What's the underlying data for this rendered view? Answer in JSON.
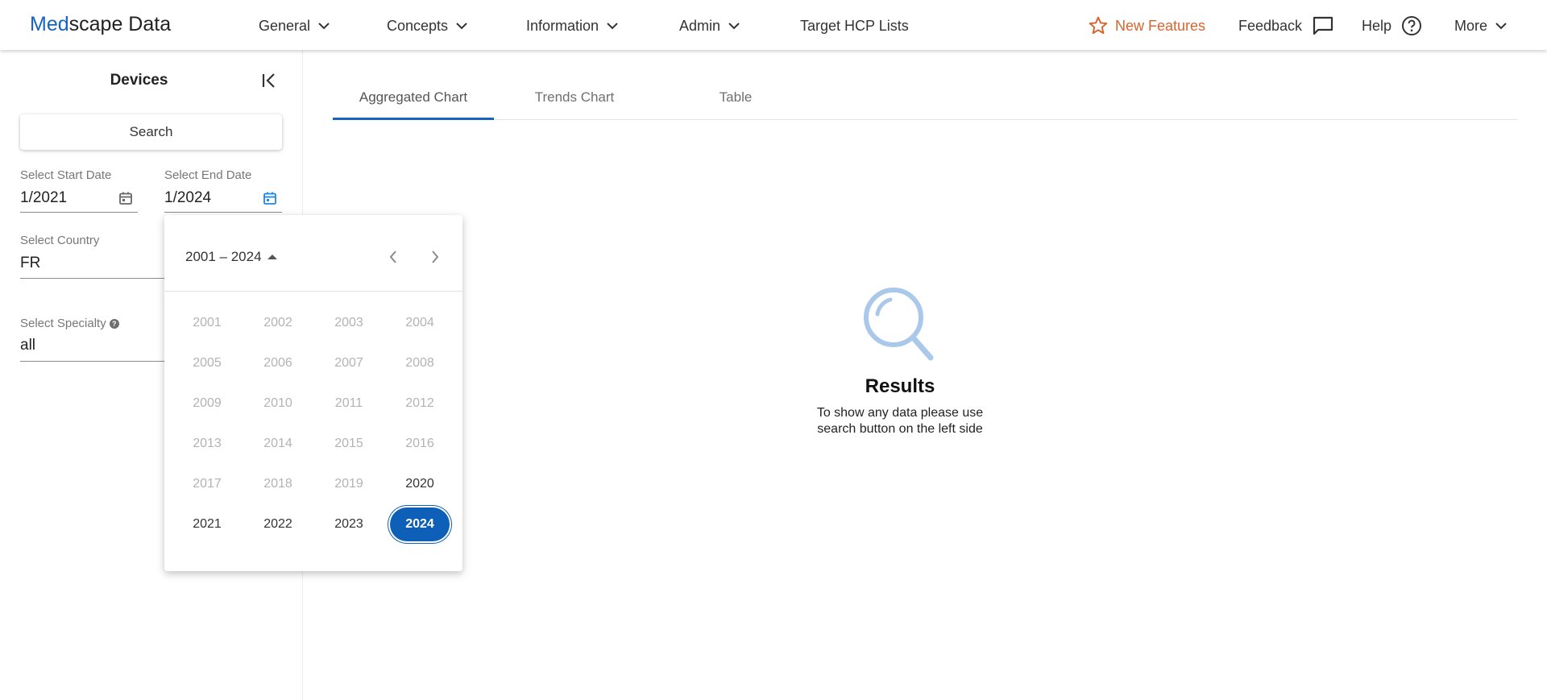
{
  "app": {
    "logo_prefix": "Med",
    "logo_suffix": "scape Data"
  },
  "nav": {
    "general": "General",
    "concepts": "Concepts",
    "information": "Information",
    "admin": "Admin",
    "target_hcp": "Target HCP Lists",
    "new_features": "New Features",
    "feedback": "Feedback",
    "help": "Help",
    "more": "More"
  },
  "sidebar": {
    "title": "Devices",
    "search_label": "Search",
    "start_date": {
      "label": "Select Start Date",
      "value": "1/2021"
    },
    "end_date": {
      "label": "Select End Date",
      "value": "1/2024"
    },
    "country": {
      "label": "Select Country",
      "value": "FR"
    },
    "specialty": {
      "label": "Select Specialty",
      "value": "all"
    }
  },
  "year_picker": {
    "range_label": "2001 – 2024",
    "selected": "2024",
    "years": [
      {
        "year": "2001",
        "state": "disabled"
      },
      {
        "year": "2002",
        "state": "disabled"
      },
      {
        "year": "2003",
        "state": "disabled"
      },
      {
        "year": "2004",
        "state": "disabled"
      },
      {
        "year": "2005",
        "state": "disabled"
      },
      {
        "year": "2006",
        "state": "disabled"
      },
      {
        "year": "2007",
        "state": "disabled"
      },
      {
        "year": "2008",
        "state": "disabled"
      },
      {
        "year": "2009",
        "state": "disabled"
      },
      {
        "year": "2010",
        "state": "disabled"
      },
      {
        "year": "2011",
        "state": "disabled"
      },
      {
        "year": "2012",
        "state": "disabled"
      },
      {
        "year": "2013",
        "state": "disabled"
      },
      {
        "year": "2014",
        "state": "disabled"
      },
      {
        "year": "2015",
        "state": "disabled"
      },
      {
        "year": "2016",
        "state": "disabled"
      },
      {
        "year": "2017",
        "state": "disabled"
      },
      {
        "year": "2018",
        "state": "disabled"
      },
      {
        "year": "2019",
        "state": "disabled"
      },
      {
        "year": "2020",
        "state": "enabled"
      },
      {
        "year": "2021",
        "state": "enabled"
      },
      {
        "year": "2022",
        "state": "enabled"
      },
      {
        "year": "2023",
        "state": "enabled"
      },
      {
        "year": "2024",
        "state": "selected"
      }
    ]
  },
  "tabs": {
    "aggregated": "Aggregated Chart",
    "trends": "Trends Chart",
    "table": "Table",
    "active": "aggregated"
  },
  "results": {
    "title": "Results",
    "line1": "To show any data please use",
    "line2": "search button on the left side"
  },
  "colors": {
    "brand_blue": "#1565c0",
    "accent_orange": "#d4652f",
    "selected_year": "#0d5fb8",
    "results_icon": "#a9c8ea"
  },
  "icons": {
    "new_features": "star-outline-icon",
    "feedback": "chat-bubble-icon",
    "help": "help-circle-icon",
    "nav_dropdown": "chevron-down-icon",
    "collapse": "collapse-left-icon",
    "date": "calendar-icon",
    "results": "magnifier-icon"
  }
}
